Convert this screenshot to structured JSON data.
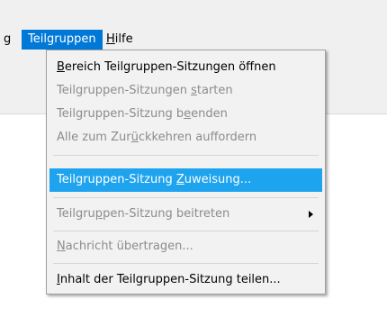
{
  "menubar": {
    "cut_item": "g",
    "active_menu": {
      "pre": "Teil",
      "key": "g",
      "post": "ruppen"
    },
    "help_menu": {
      "key": "H",
      "post": "ilfe"
    }
  },
  "menu": {
    "items": [
      {
        "pre": "",
        "key": "B",
        "post": "ereich Teilgruppen-Sitzungen öffnen"
      },
      {
        "pre": "Teilgruppen-Sitzungen ",
        "key": "s",
        "post": "tarten"
      },
      {
        "pre": "Teilgruppen-Sitzung b",
        "key": "e",
        "post": "enden"
      },
      {
        "pre": "Alle zum Zur",
        "key": "ü",
        "post": "ckkehren auffordern"
      },
      {
        "pre": "Teilgruppen-Sitzung ",
        "key": "Z",
        "post": "uweisung..."
      },
      {
        "pre": "Teilgru",
        "key": "p",
        "post": "pen-Sitzung beitreten"
      },
      {
        "pre": "",
        "key": "N",
        "post": "achricht übertragen..."
      },
      {
        "pre": "",
        "key": "I",
        "post": "nhalt der Teilgruppen-Sitzung teilen..."
      }
    ]
  },
  "colors": {
    "menubar_active": "#0078d7",
    "item_highlight": "#1ea3ef",
    "disabled_text": "#8c8c8c"
  }
}
